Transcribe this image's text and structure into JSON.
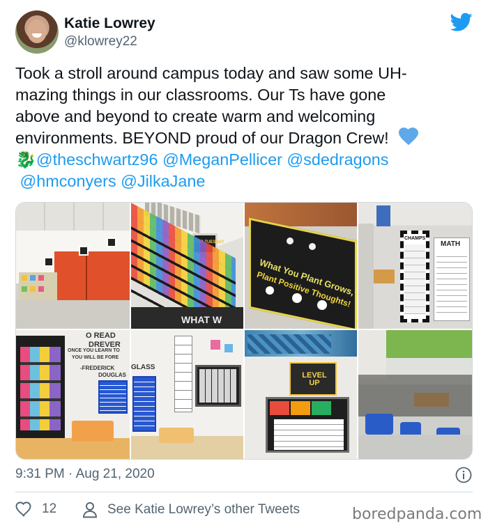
{
  "author": {
    "name": "Katie Lowrey",
    "handle": "@klowrey22"
  },
  "tweet": {
    "line1": "Took a stroll around campus today and saw some UH-",
    "line2": "mazing things in our classrooms. Our Ts have gone",
    "line3": "above and beyond to create warm and welcoming",
    "line4": "environments. BEYOND proud of our Dragon Crew!",
    "dragon_emoji": "🐉",
    "mentions": [
      "@theschwartz96",
      "@MeganPellicer",
      "@sdedragons",
      "@hmconyers",
      "@JilkaJane"
    ]
  },
  "photos": {
    "p2_sign": "FOR TUESDAY",
    "p2_bottom": "WHAT W",
    "p3_line1": "What You Plant Grows,",
    "p3_line2": "Plant Positive Thoughts!",
    "p4_champs": "CHAMPS",
    "p4_math": "MATH",
    "p5_quote1": "O READ",
    "p5_quote2": "DREVER",
    "p5_quote3": "ONCE YOU LEARN TO",
    "p5_quote4": "YOU WILL BE FORE",
    "p5_author": "-FREDERICK",
    "p5_author2": "DOUGLAS",
    "p5_glass": "GLASS",
    "p6_level": "LEVEL UP"
  },
  "meta": {
    "time": "9:31 PM · Aug 21, 2020",
    "likes": "12",
    "other_tweets": "See Katie Lowrey’s other Tweets",
    "watermark": "boredpanda.com"
  },
  "icons": {
    "bird": "twitter-bird-icon",
    "heart": "blue-heart-icon",
    "info": "info-icon",
    "like": "heart-outline-icon",
    "person": "person-icon"
  },
  "colors": {
    "text": "#0f1419",
    "secondary": "#536471",
    "link": "#1d9bf0",
    "heart": "#5fa8ea"
  }
}
